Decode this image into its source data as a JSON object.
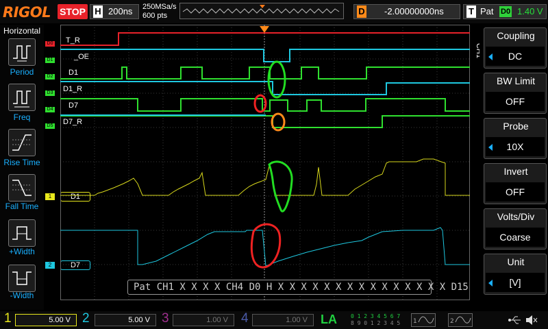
{
  "header": {
    "brand": "RIGOL",
    "run_state": "STOP",
    "timebase_letter": "H",
    "timebase": "200ns",
    "sample_rate": "250MSa/s",
    "memory_depth": "600 pts",
    "delay_letter": "D",
    "delay": "-2.00000000ns",
    "trigger_letter": "T",
    "trigger_type": "Pat",
    "trigger_source": "D0",
    "trigger_level": "1.40 V"
  },
  "left_menu": {
    "title": "Horizontal",
    "items": [
      {
        "label": "Period",
        "icon": "period-icon"
      },
      {
        "label": "Freq",
        "icon": "frequency-icon"
      },
      {
        "label": "Rise Time",
        "icon": "rise-time-icon"
      },
      {
        "label": "Fall Time",
        "icon": "fall-time-icon"
      },
      {
        "label": "+Width",
        "icon": "positive-width-icon"
      },
      {
        "label": "-Width",
        "icon": "negative-width-icon"
      }
    ]
  },
  "right_menu": {
    "channel_tag": "CH1",
    "items": [
      {
        "title": "Coupling",
        "value": "DC"
      },
      {
        "title": "BW Limit",
        "value": "OFF"
      },
      {
        "title": "Probe",
        "value": "10X"
      },
      {
        "title": "Invert",
        "value": "OFF"
      },
      {
        "title": "Volts/Div",
        "value": "Coarse"
      },
      {
        "title": "Unit",
        "value": "[V]"
      }
    ]
  },
  "digital_channels": [
    {
      "tag": "D0",
      "name": "T_R",
      "color": "#e8222a"
    },
    {
      "tag": "D1",
      "name": "_OE",
      "color": "#1ec8e0"
    },
    {
      "tag": "D2",
      "name": "D1",
      "color": "#2fe02f"
    },
    {
      "tag": "D3",
      "name": "D1_R",
      "color": "#1ec8e0"
    },
    {
      "tag": "D4",
      "name": "D7",
      "color": "#2fe02f"
    },
    {
      "tag": "D5",
      "name": "D7_R",
      "color": "#2fe02f"
    }
  ],
  "analog_labels": [
    {
      "num": "1",
      "label": "D1",
      "color": "#d8d81c"
    },
    {
      "num": "2",
      "label": "D7",
      "color": "#1ec8e0"
    }
  ],
  "pattern_bar": "Pat  CH1 X X X X  CH4 D0 H X X X X X X X X X X X X X X X D15",
  "bottom": {
    "ch1": {
      "num": "1",
      "scale": "5.00 V",
      "color": "#e8e81c"
    },
    "ch2": {
      "num": "2",
      "scale": "5.00 V",
      "color": "#1ec8e0"
    },
    "ch3": {
      "num": "3",
      "scale": "1.00 V",
      "color": "#a03090"
    },
    "ch4": {
      "num": "4",
      "scale": "1.00 V",
      "color": "#4a5aa8"
    },
    "la": "LA",
    "la_row1": "0 1 2 3  4 5 6 7",
    "la_row2": "8 9 0 1  2 3 4 5"
  },
  "colors": {
    "accent_orange": "#ff7a1a",
    "menu_blue": "#1ab0ff",
    "stop_red": "#e8222a",
    "annotation_green": "#22dd22",
    "annotation_red": "#ee2222",
    "annotation_orange": "#ff8a1a"
  }
}
